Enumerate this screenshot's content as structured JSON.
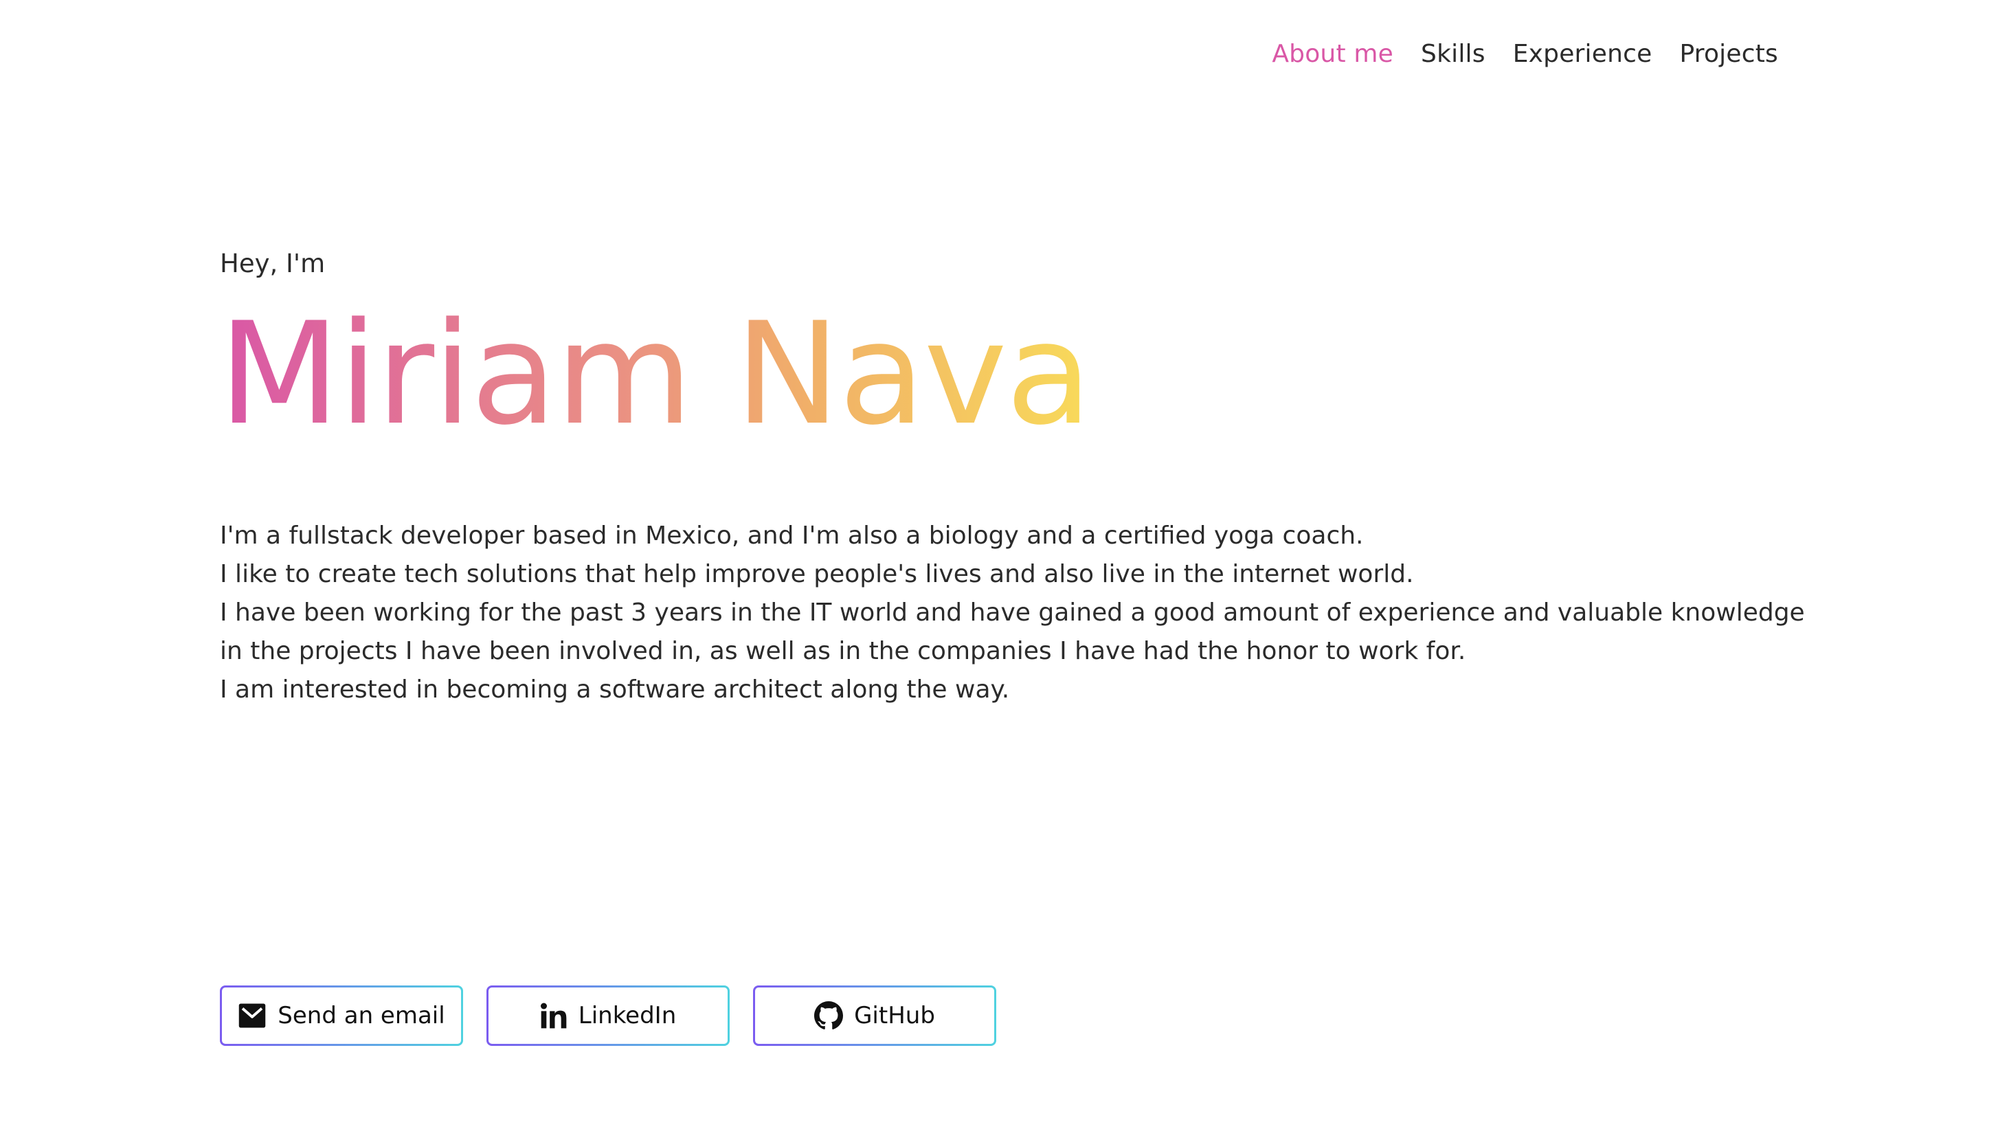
{
  "nav": {
    "items": [
      {
        "label": "About me",
        "active": true
      },
      {
        "label": "Skills",
        "active": false
      },
      {
        "label": "Experience",
        "active": false
      },
      {
        "label": "Projects",
        "active": false
      }
    ],
    "active_color": "#d957a6"
  },
  "hero": {
    "greeting": "Hey, I'm",
    "name": "Miriam Nava",
    "name_gradient": [
      "#d957a6",
      "#ea8f84",
      "#f1b068",
      "#f8da5a"
    ]
  },
  "bio": {
    "lines": [
      "I'm a fullstack developer based in Mexico, and I'm also a biology and a certified yoga coach.",
      "I like to create tech solutions that help improve people's lives and also live in the internet world.",
      "I have been working for the past 3 years in the IT world and have gained a good amount of experience and valuable knowledge",
      "in the projects I have been involved in, as well as in the companies I have had the honor to work for.",
      "I am interested in becoming a software architect along the way."
    ]
  },
  "contacts": {
    "buttons": [
      {
        "label": "Send an email",
        "icon": "mail-icon"
      },
      {
        "label": "LinkedIn",
        "icon": "linkedin-icon"
      },
      {
        "label": "GitHub",
        "icon": "github-icon"
      }
    ],
    "border_gradient": [
      "#7b5cf0",
      "#4fd2e0"
    ]
  }
}
